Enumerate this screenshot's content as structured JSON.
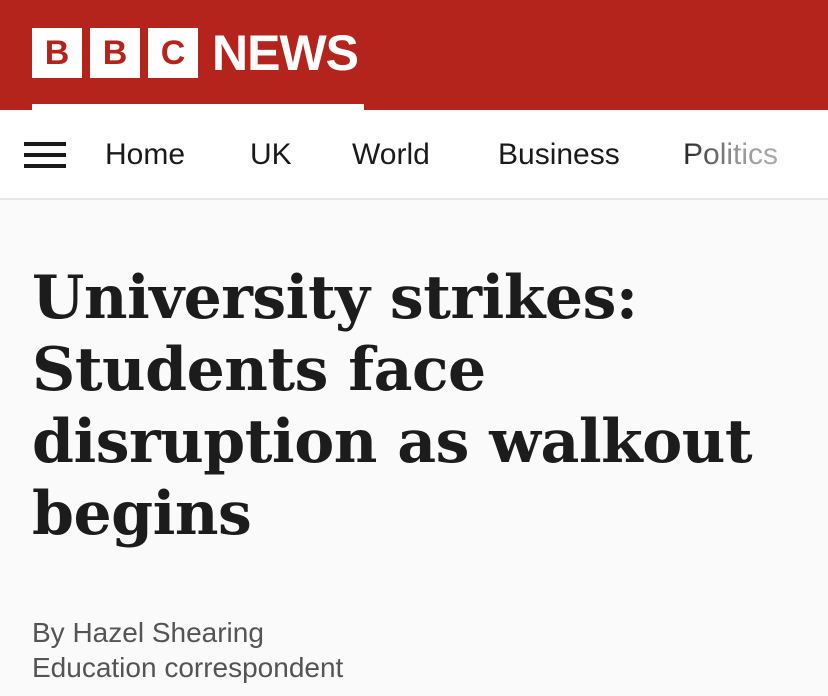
{
  "masthead": {
    "logo_letters": [
      "B",
      "B",
      "C"
    ],
    "logo_word": "NEWS",
    "brand_color": "#b5241c"
  },
  "nav": {
    "menu_icon": "hamburger-menu-icon",
    "items": [
      {
        "label": "Home"
      },
      {
        "label": "UK"
      },
      {
        "label": "World"
      },
      {
        "label": "Business"
      },
      {
        "label": "Politics"
      }
    ]
  },
  "article": {
    "headline": "University strikes: Students face disruption as walkout begins",
    "author": "By Hazel Shearing",
    "author_role": "Education correspondent"
  }
}
